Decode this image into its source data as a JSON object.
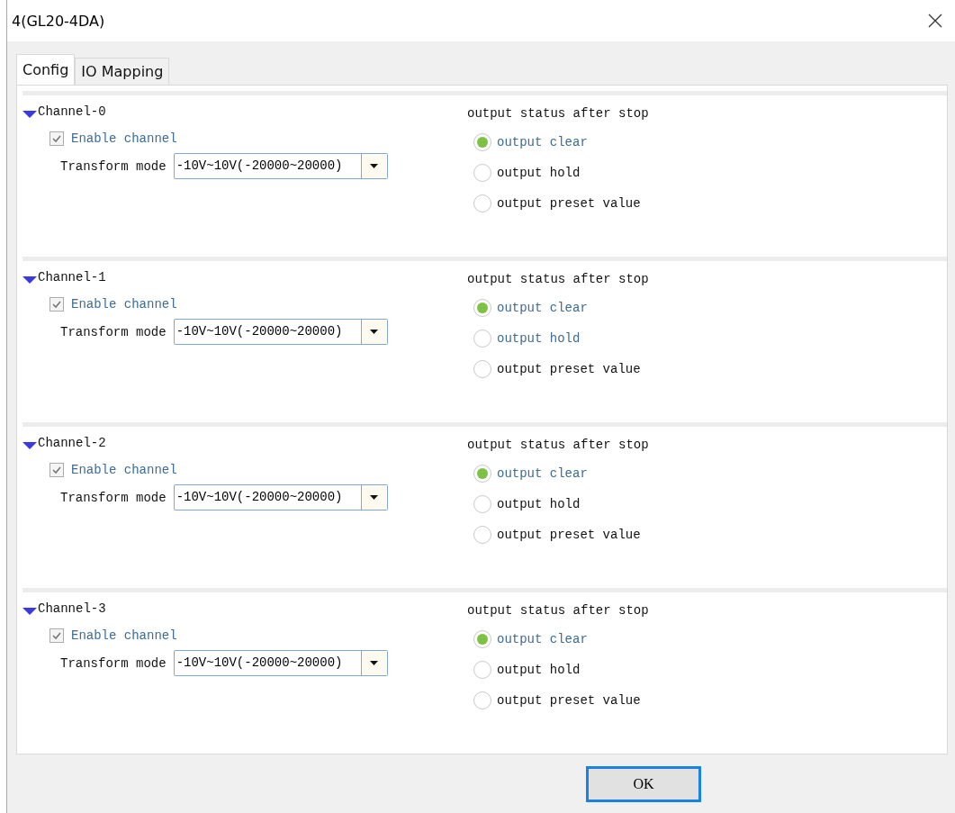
{
  "window": {
    "title": "4(GL20-4DA)"
  },
  "tabs": [
    {
      "label": "Config",
      "selected": true
    },
    {
      "label": "IO Mapping",
      "selected": false
    }
  ],
  "channels": [
    {
      "name": "Channel-0",
      "expanded": true,
      "enable": {
        "label": "Enable channel",
        "checked": true,
        "disabled": true
      },
      "transform": {
        "label": "Transform mode",
        "value": "-10V~10V(-20000~20000)"
      },
      "output_title": "output status after stop",
      "options": [
        {
          "label": "output clear",
          "selected": true,
          "highlighted": true
        },
        {
          "label": "output hold",
          "selected": false,
          "highlighted": false
        },
        {
          "label": "output preset value",
          "selected": false,
          "highlighted": false
        }
      ]
    },
    {
      "name": "Channel-1",
      "expanded": true,
      "enable": {
        "label": "Enable channel",
        "checked": true,
        "disabled": true
      },
      "transform": {
        "label": "Transform mode",
        "value": "-10V~10V(-20000~20000)"
      },
      "output_title": "output status after stop",
      "options": [
        {
          "label": "output clear",
          "selected": true,
          "highlighted": true
        },
        {
          "label": "output hold",
          "selected": false,
          "highlighted": true
        },
        {
          "label": "output preset value",
          "selected": false,
          "highlighted": false
        }
      ]
    },
    {
      "name": "Channel-2",
      "expanded": true,
      "enable": {
        "label": "Enable channel",
        "checked": true,
        "disabled": true
      },
      "transform": {
        "label": "Transform mode",
        "value": "-10V~10V(-20000~20000)"
      },
      "output_title": "output status after stop",
      "options": [
        {
          "label": "output clear",
          "selected": true,
          "highlighted": true
        },
        {
          "label": "output hold",
          "selected": false,
          "highlighted": false
        },
        {
          "label": "output preset value",
          "selected": false,
          "highlighted": false
        }
      ]
    },
    {
      "name": "Channel-3",
      "expanded": true,
      "enable": {
        "label": "Enable channel",
        "checked": true,
        "disabled": true
      },
      "transform": {
        "label": "Transform mode",
        "value": "-10V~10V(-20000~20000)"
      },
      "output_title": "output status after stop",
      "options": [
        {
          "label": "output clear",
          "selected": true,
          "highlighted": true
        },
        {
          "label": "output hold",
          "selected": false,
          "highlighted": false
        },
        {
          "label": "output preset value",
          "selected": false,
          "highlighted": false
        }
      ]
    }
  ],
  "buttons": [
    {
      "label": "OK"
    }
  ]
}
